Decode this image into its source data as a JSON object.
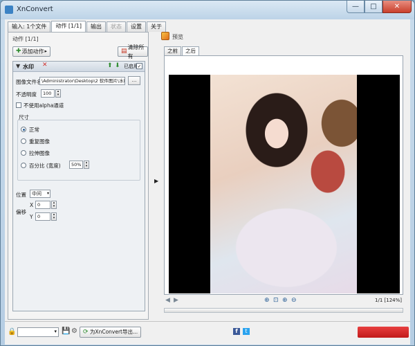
{
  "window": {
    "title": "XnConvert",
    "min_glyph": "—",
    "max_glyph": "□",
    "close_glyph": "✕"
  },
  "tabs": [
    {
      "label": "输入: 1个文件",
      "active": false,
      "disabled": false
    },
    {
      "label": "动作 [1/1]",
      "active": true,
      "disabled": false
    },
    {
      "label": "输出",
      "active": false,
      "disabled": false
    },
    {
      "label": "状态",
      "active": false,
      "disabled": true
    },
    {
      "label": "设置",
      "active": false,
      "disabled": false
    },
    {
      "label": "关于",
      "active": false,
      "disabled": false
    }
  ],
  "actions_panel": {
    "caption": "动作 [1/1]",
    "add_action_label": "添加动作",
    "clear_all_label": "清除所有",
    "action": {
      "title": "水印",
      "enabled_label": "已启用",
      "enabled": true,
      "image_file_label": "图像文件名",
      "image_file_value": "\\Administrator\\Desktop\\2 软件图片\\水印.png",
      "browse_label": "...",
      "opacity_label": "不透明度",
      "opacity_value": "100",
      "no_alpha_label": "不使用alpha通道",
      "size_group_label": "尺寸",
      "size_options": [
        {
          "label": "正常",
          "checked": true
        },
        {
          "label": "重复图像",
          "checked": false
        },
        {
          "label": "拉伸图像",
          "checked": false
        },
        {
          "label": "百分比 (宽度)",
          "checked": false
        }
      ],
      "percent_value": "50%",
      "position_label": "位置",
      "position_value": "中间",
      "offset_label": "偏移",
      "x_label": "X",
      "x_value": "0",
      "y_label": "Y",
      "y_value": "0"
    }
  },
  "preview": {
    "label": "预览",
    "tabs": [
      {
        "label": "之前",
        "active": false
      },
      {
        "label": "之后",
        "active": true
      }
    ],
    "page_info": "1/1 [124%]"
  },
  "bottom": {
    "export_label": "为XnConvert导出..."
  },
  "icons": {
    "lock": "🔒",
    "save": "💾",
    "gear": "⚙",
    "facebook": "f",
    "twitter": "t",
    "prev": "◀",
    "next": "▶",
    "zoom_in": "⊕",
    "fit": "⊡",
    "zoom_out": "⊖",
    "splitter": "▶",
    "up": "⬆",
    "down": "⬇",
    "collapse": "▼",
    "remove": "✕"
  }
}
